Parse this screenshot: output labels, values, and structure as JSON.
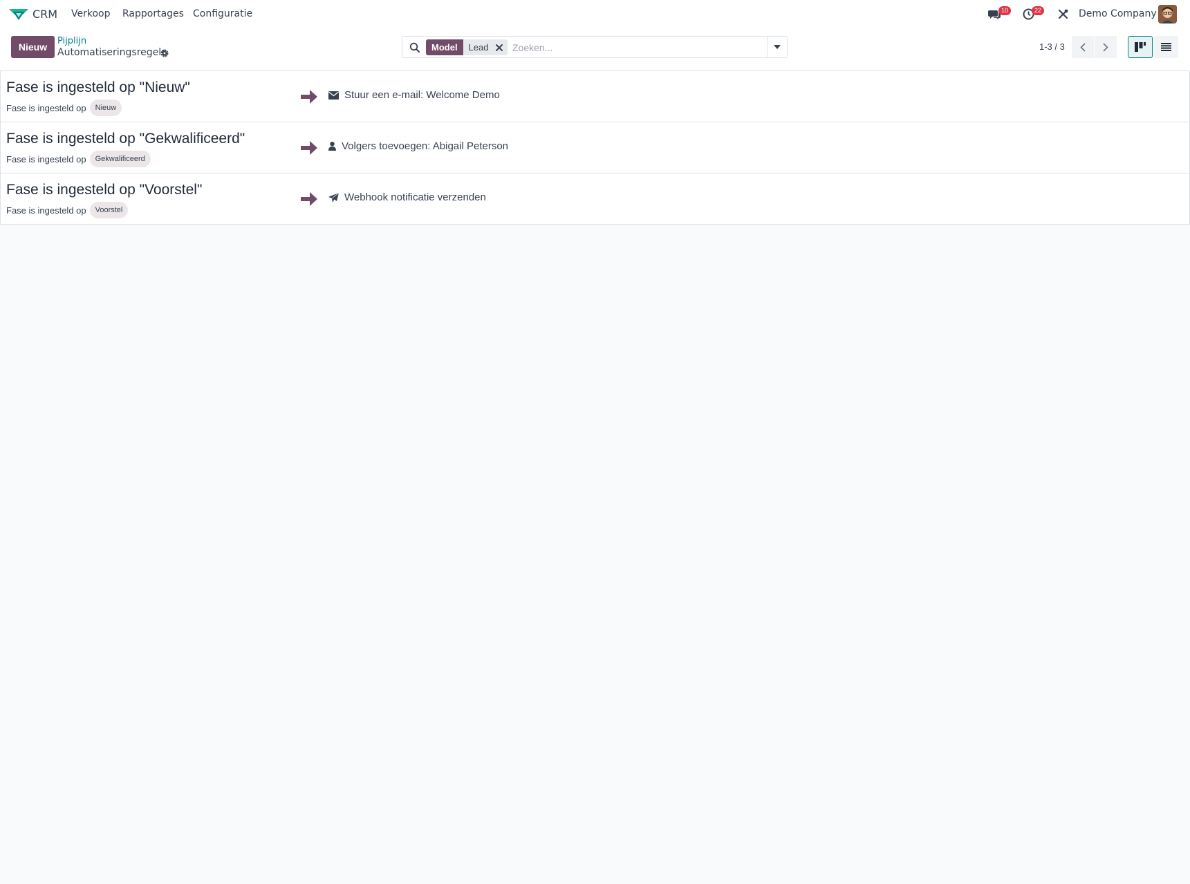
{
  "navbar": {
    "app_name": "CRM",
    "menu": [
      "Verkoop",
      "Rapportages",
      "Configuratie"
    ],
    "messages_count": "10",
    "activities_count": "22",
    "company": "Demo Company"
  },
  "control_panel": {
    "new_button": "Nieuw",
    "breadcrumb_parent": "Pijplijn",
    "breadcrumb_current": "Automatiseringsregels",
    "search": {
      "facet_label": "Model",
      "facet_value": "Lead",
      "placeholder": "Zoeken..."
    },
    "pager": "1-3 / 3"
  },
  "rules": [
    {
      "title": "Fase is ingesteld op \"Nieuw\"",
      "trigger_text": "Fase is ingesteld op",
      "stage": "Nieuw",
      "action_icon": "envelope-icon",
      "action": "Stuur een e-mail: Welcome Demo"
    },
    {
      "title": "Fase is ingesteld op \"Gekwalificeerd\"",
      "trigger_text": "Fase is ingesteld op",
      "stage": "Gekwalificeerd",
      "action_icon": "user-icon",
      "action": "Volgers toevoegen: Abigail Peterson"
    },
    {
      "title": "Fase is ingesteld op \"Voorstel\"",
      "trigger_text": "Fase is ingesteld op",
      "stage": "Voorstel",
      "action_icon": "paper-plane-icon",
      "action": "Webhook notificatie verzenden"
    }
  ],
  "colors": {
    "brand": "#714b67",
    "link": "#017e84",
    "badge": "#dc3545",
    "background": "#f9fafb"
  }
}
